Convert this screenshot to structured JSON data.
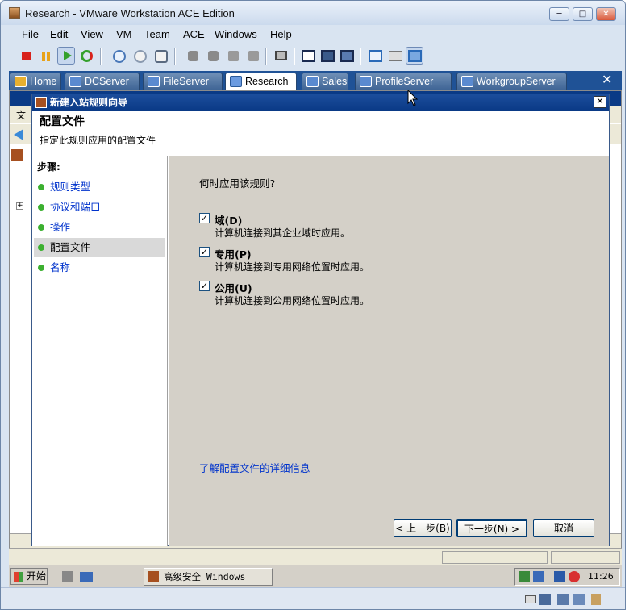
{
  "window": {
    "title": "Research - VMware Workstation ACE Edition",
    "buttons": [
      "─",
      "□",
      "✕"
    ]
  },
  "menu": [
    "File",
    "Edit",
    "View",
    "VM",
    "Team",
    "ACE",
    "Windows",
    "Help"
  ],
  "toolbar": {
    "icons": [
      "stop-icon",
      "pause-icon",
      "play-icon",
      "reset-icon",
      "snapshot-icon",
      "revert-snapshot-icon",
      "snapshot-manager-icon",
      "team-icon-1",
      "team-icon-2",
      "team-icon-3",
      "team-icon-4",
      "console-icon",
      "quick-switch-icon",
      "full-screen-icon",
      "fit-guest-icon",
      "summary-icon",
      "appliance-icon",
      "console-view-icon"
    ]
  },
  "tabs": [
    {
      "label": "Home",
      "active": false
    },
    {
      "label": "DCServer",
      "active": false
    },
    {
      "label": "FileServer",
      "active": false
    },
    {
      "label": "Research",
      "active": true
    },
    {
      "label": "Sales",
      "active": false
    },
    {
      "label": "ProfileServer",
      "active": false
    },
    {
      "label": "WorkgroupServer",
      "active": false
    }
  ],
  "dialog": {
    "title": "新建入站规则向导",
    "header_title": "配置文件",
    "header_subtitle": "指定此规则应用的配置文件",
    "steps_title": "步骤:",
    "steps": [
      {
        "label": "规则类型",
        "current": false
      },
      {
        "label": "协议和端口",
        "current": false
      },
      {
        "label": "操作",
        "current": false
      },
      {
        "label": "配置文件",
        "current": true
      },
      {
        "label": "名称",
        "current": false
      }
    ],
    "question": "何时应用该规则?",
    "options": [
      {
        "label": "域(D)",
        "description": "计算机连接到其企业域时应用。",
        "checked": true
      },
      {
        "label": "专用(P)",
        "description": "计算机连接到专用网络位置时应用。",
        "checked": true
      },
      {
        "label": "公用(U)",
        "description": "计算机连接到公用网络位置时应用。",
        "checked": true
      }
    ],
    "link": "了解配置文件的详细信息",
    "back_button": "< 上一步(B)",
    "next_button": "下一步(N) >",
    "cancel_button": "取消",
    "close": "✕"
  },
  "mmc": {
    "menu_first": "文"
  },
  "taskbar": {
    "start_label": "开始",
    "task_label": "高级安全 Windows 防...",
    "clock": "11:26"
  },
  "colors": {
    "tab_strip": "#1f5296",
    "dialog_title": "#0a3a86",
    "link": "#0033cc",
    "step_dot": "#3cb030"
  }
}
